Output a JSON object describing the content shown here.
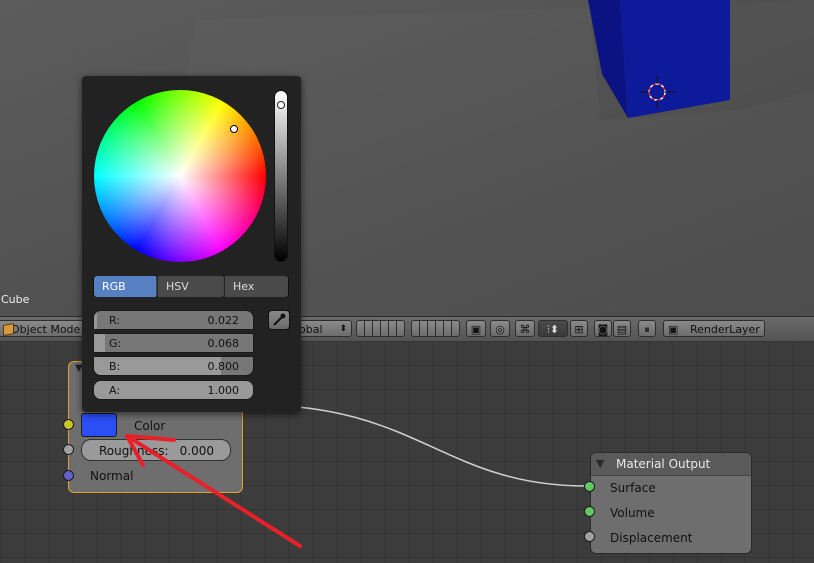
{
  "viewport": {
    "object_name": "Cube"
  },
  "header": {
    "mode_label": "Object Mode",
    "pivot_label": "obal",
    "render_layer_label": "RenderLayer"
  },
  "color_picker": {
    "tabs": [
      {
        "label": "RGB",
        "active": true
      },
      {
        "label": "HSV",
        "active": false
      },
      {
        "label": "Hex",
        "active": false
      }
    ],
    "channels": [
      {
        "label": "R:",
        "value": "0.022",
        "fraction": 0.022
      },
      {
        "label": "G:",
        "value": "0.068",
        "fraction": 0.068
      },
      {
        "label": "B:",
        "value": "0.800",
        "fraction": 0.8
      },
      {
        "label": "A:",
        "value": "1.000",
        "fraction": 1.0
      }
    ],
    "current_color": "#1b3cf2"
  },
  "shader_node": {
    "color_label": "Color",
    "roughness_label": "Roughness:",
    "roughness_value": "0.000",
    "normal_label": "Normal",
    "swatch_color": "#2b4ef5"
  },
  "output_node": {
    "title": "Material Output",
    "inputs": [
      "Surface",
      "Volume",
      "Displacement"
    ]
  },
  "colors": {
    "accent_blue": "#5680c2",
    "socket_yellow": "#c7c729",
    "socket_gray": "#a1a1a1",
    "socket_blue": "#6363c7",
    "socket_green": "#63c763",
    "annotation_red": "#e8202a"
  }
}
